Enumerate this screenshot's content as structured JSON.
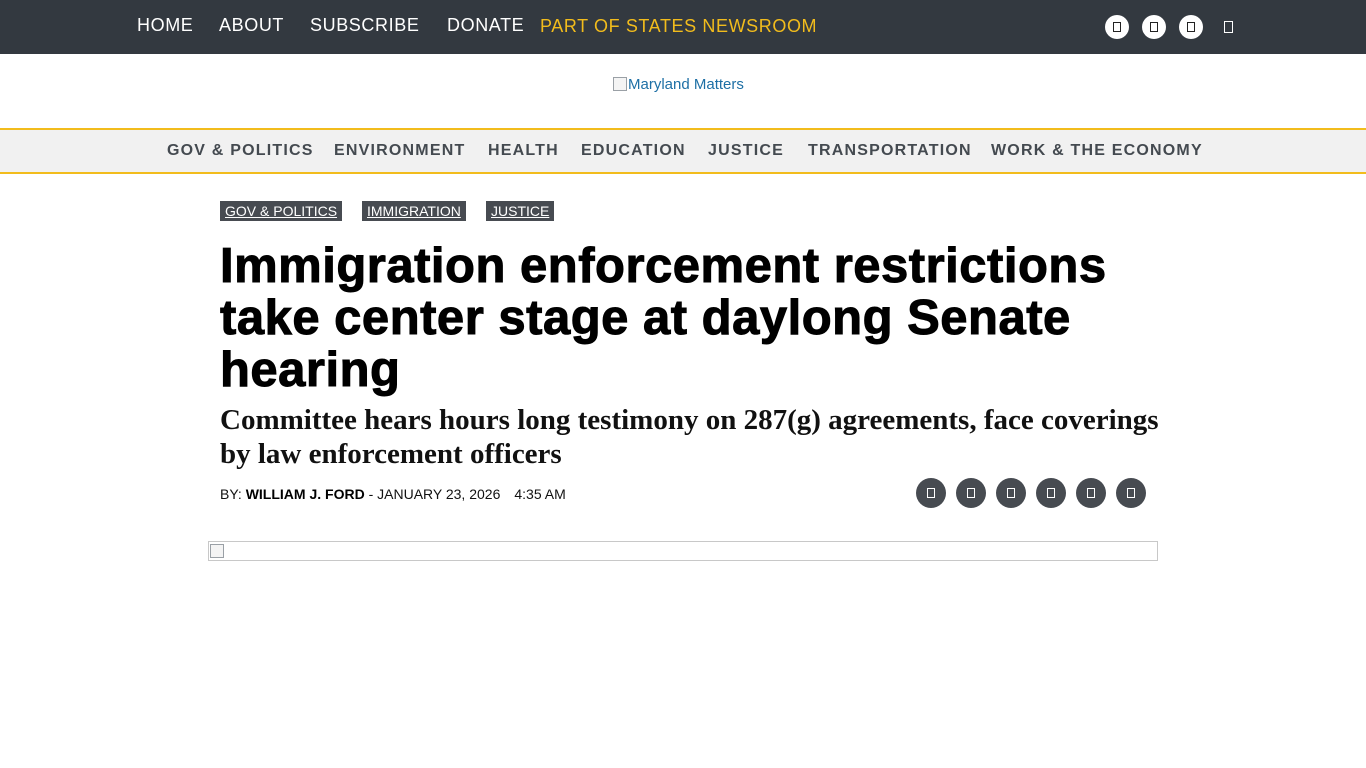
{
  "topbar": {
    "nav": [
      "HOME",
      "ABOUT",
      "SUBSCRIBE",
      "DONATE"
    ],
    "states_newsroom": "PART OF STATES NEWSROOM",
    "social_icons": [
      "social-icon",
      "social-icon",
      "social-icon"
    ],
    "search_icon": "search-icon"
  },
  "logo": {
    "alt": "Maryland Matters"
  },
  "section_nav": [
    "GOV & POLITICS",
    "ENVIRONMENT",
    "HEALTH",
    "EDUCATION",
    "JUSTICE",
    "TRANSPORTATION",
    "WORK & THE ECONOMY"
  ],
  "article": {
    "tags": [
      "GOV & POLITICS",
      "IMMIGRATION",
      "JUSTICE"
    ],
    "headline": "Immigration enforcement restrictions take center stage at daylong Senate hearing",
    "subhead": "Committee hears hours long testimony on 287(g) agreements, face coverings by law enforcement officers",
    "byline": {
      "prefix": "BY: ",
      "author": "WILLIAM J. FORD",
      "date": " - JANUARY 23, 2026",
      "time": "4:35 AM"
    },
    "share_icons": [
      "share-icon",
      "share-icon",
      "share-icon",
      "share-icon",
      "share-icon",
      "share-icon"
    ]
  },
  "colors": {
    "topbar_bg": "#333940",
    "accent_yellow": "#f2bc1c",
    "tag_bg": "#474b51",
    "section_nav_bg": "#f1f1f1"
  }
}
